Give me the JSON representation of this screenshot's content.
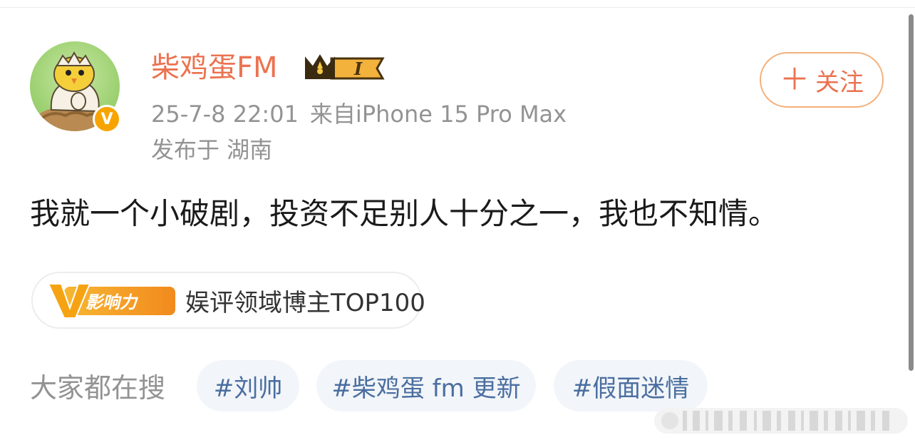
{
  "post": {
    "author": {
      "name": "柴鸡蛋FM",
      "verified_badge": "V",
      "member_level": "I"
    },
    "meta": {
      "timestamp": "25-7-8 22:01",
      "source": "来自iPhone 15 Pro Max",
      "location": "发布于 湖南"
    },
    "follow_button": {
      "icon": "plus-icon",
      "label": "关注"
    },
    "text": "我就一个小破剧，投资不足别人十分之一，我也不知情。",
    "influence": {
      "logo_text": "影响力",
      "logo_letter": "V",
      "label": "娱评领域博主TOP100"
    },
    "hot_search": {
      "label": "大家都在搜",
      "tags": [
        "#刘帅",
        "#柴鸡蛋 fm 更新",
        "#假面迷情"
      ]
    }
  },
  "colors": {
    "brand_orange": "#eb7350",
    "meta_gray": "#939393",
    "tag_blue": "#4a6ea0",
    "tag_bg": "#f2f5f9",
    "badge_gold": "#f7a400"
  }
}
